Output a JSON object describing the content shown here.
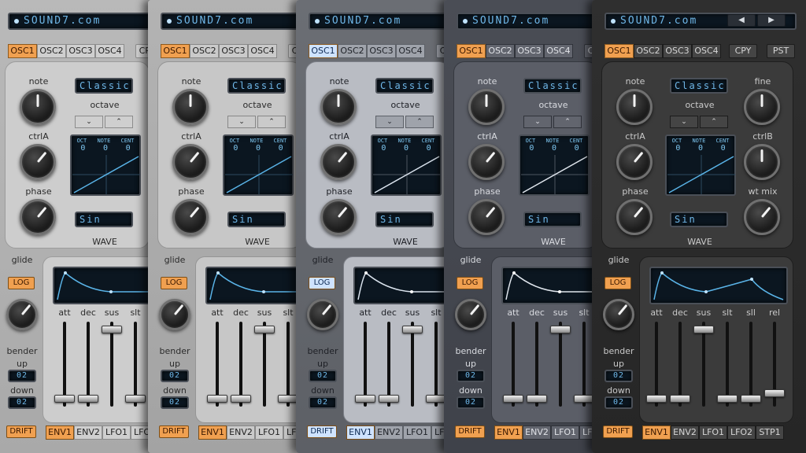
{
  "colors": {
    "lcd_text": "#6fb7e8",
    "accent_orange": "#f0a050",
    "accent_blue": "#cfe3ff"
  },
  "title": "SOUND7.com",
  "nav_prev": "◀",
  "nav_next": "▶",
  "osc_tabs": [
    "OSC1",
    "OSC2",
    "OSC3",
    "OSC4"
  ],
  "copy_label": "CPY",
  "paste_label": "PST",
  "knobs": {
    "note": "note",
    "ctrlA": "ctrlA",
    "phase": "phase",
    "fine": "fine",
    "ctrlB": "ctrlB",
    "wt_mix": "wt mix"
  },
  "octave_label": "octave",
  "octave_down": "⌄",
  "octave_up": "⌃",
  "preset_value": "Classic",
  "scope": {
    "oct_label": "OCT",
    "note_label": "NOTE",
    "cent_label": "CENT",
    "oct_value": "0",
    "note_value": "0",
    "cent_value": "0"
  },
  "wave_value": "Sin",
  "wave_label": "WAVE",
  "glide_label": "glide",
  "log_label": "LOG",
  "bender_label": "bender",
  "up_label": "up",
  "down_label": "down",
  "bender_up_value": "02",
  "bender_down_value": "02",
  "drift_label": "DRIFT",
  "envelope_sliders": [
    {
      "label": "att",
      "level": 0.05
    },
    {
      "label": "dec",
      "level": 0.05
    },
    {
      "label": "sus",
      "level": 0.95
    },
    {
      "label": "slt",
      "level": 0.05
    },
    {
      "label": "sll",
      "level": 0.05
    },
    {
      "label": "rel",
      "level": 0.12
    }
  ],
  "bottom_tabs": [
    "ENV1",
    "ENV2",
    "LFO1",
    "LFO2",
    "STP1"
  ]
}
